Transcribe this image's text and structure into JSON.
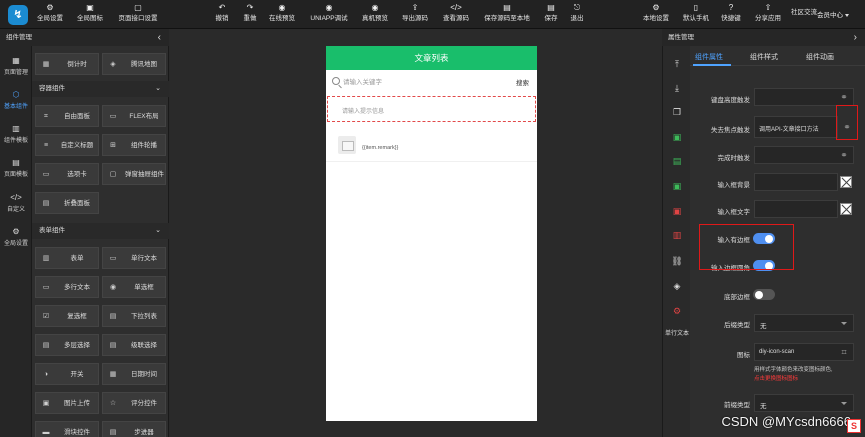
{
  "toolbar": {
    "left": [
      "全局设置",
      "全局图标",
      "页面接口设置"
    ],
    "center": [
      "撤销",
      "重做",
      "在线预览",
      "UNIAPP调试",
      "真机预览",
      "导出源码",
      "查看源码",
      "保存源码至本地",
      "保存",
      "退出"
    ],
    "right": [
      "本地设置",
      "默认手机",
      "快捷键",
      "分享应用",
      "社区交流"
    ],
    "member": "会员中心"
  },
  "rail": [
    "页面管理",
    "基本组件",
    "组件模板",
    "页面模板",
    "自定义",
    "全局设置"
  ],
  "comp_panel": {
    "title": "组件管理",
    "top_items": [
      "倒计时",
      "腾讯地图"
    ],
    "container_section": "容器组件",
    "container_items": [
      "自由面板",
      "FLEX布局",
      "自定义标题",
      "组件轮播",
      "选项卡",
      "弹窗抽屉组件",
      "折叠面板"
    ],
    "form_section": "表单组件",
    "form_items": [
      "表单",
      "单行文本",
      "多行文本",
      "单选框",
      "复选框",
      "下拉列表",
      "多层选择",
      "级联选择",
      "开关",
      "日期时间",
      "图片上传",
      "评分控件",
      "滑块控件",
      "步进器"
    ]
  },
  "phone": {
    "title": "文章列表",
    "search_placeholder": "请输入关键字",
    "search_button": "搜索",
    "tip": "请输入提示信息",
    "remark": "{{item.remark}}"
  },
  "prop_panel": {
    "title": "属性管理",
    "tabs": [
      "组件属性",
      "组件样式",
      "组件动画"
    ],
    "side_label": "单行文本",
    "rows": {
      "keyboard": "键盘高度触发",
      "blur": "失去焦点触发",
      "blur_value": "调用API-文章接口方法",
      "complete": "完成时触发",
      "bg": "输入框背景",
      "text_color": "输入框文字",
      "border": "输入有边框",
      "rounded": "输入边框圆角",
      "bottom_border": "底部边框",
      "suffix_type": "后缀类型",
      "suffix_value": "无",
      "icon": "图标",
      "icon_value": "diy-icon-scan",
      "icon_hint": "用样式字体颜色来改变图标颜色,",
      "icon_hint_red": "点击更换图标图标",
      "prefix_type": "前缀类型",
      "prefix_value": "无"
    }
  },
  "watermark": "CSDN @MYcsdn6666"
}
